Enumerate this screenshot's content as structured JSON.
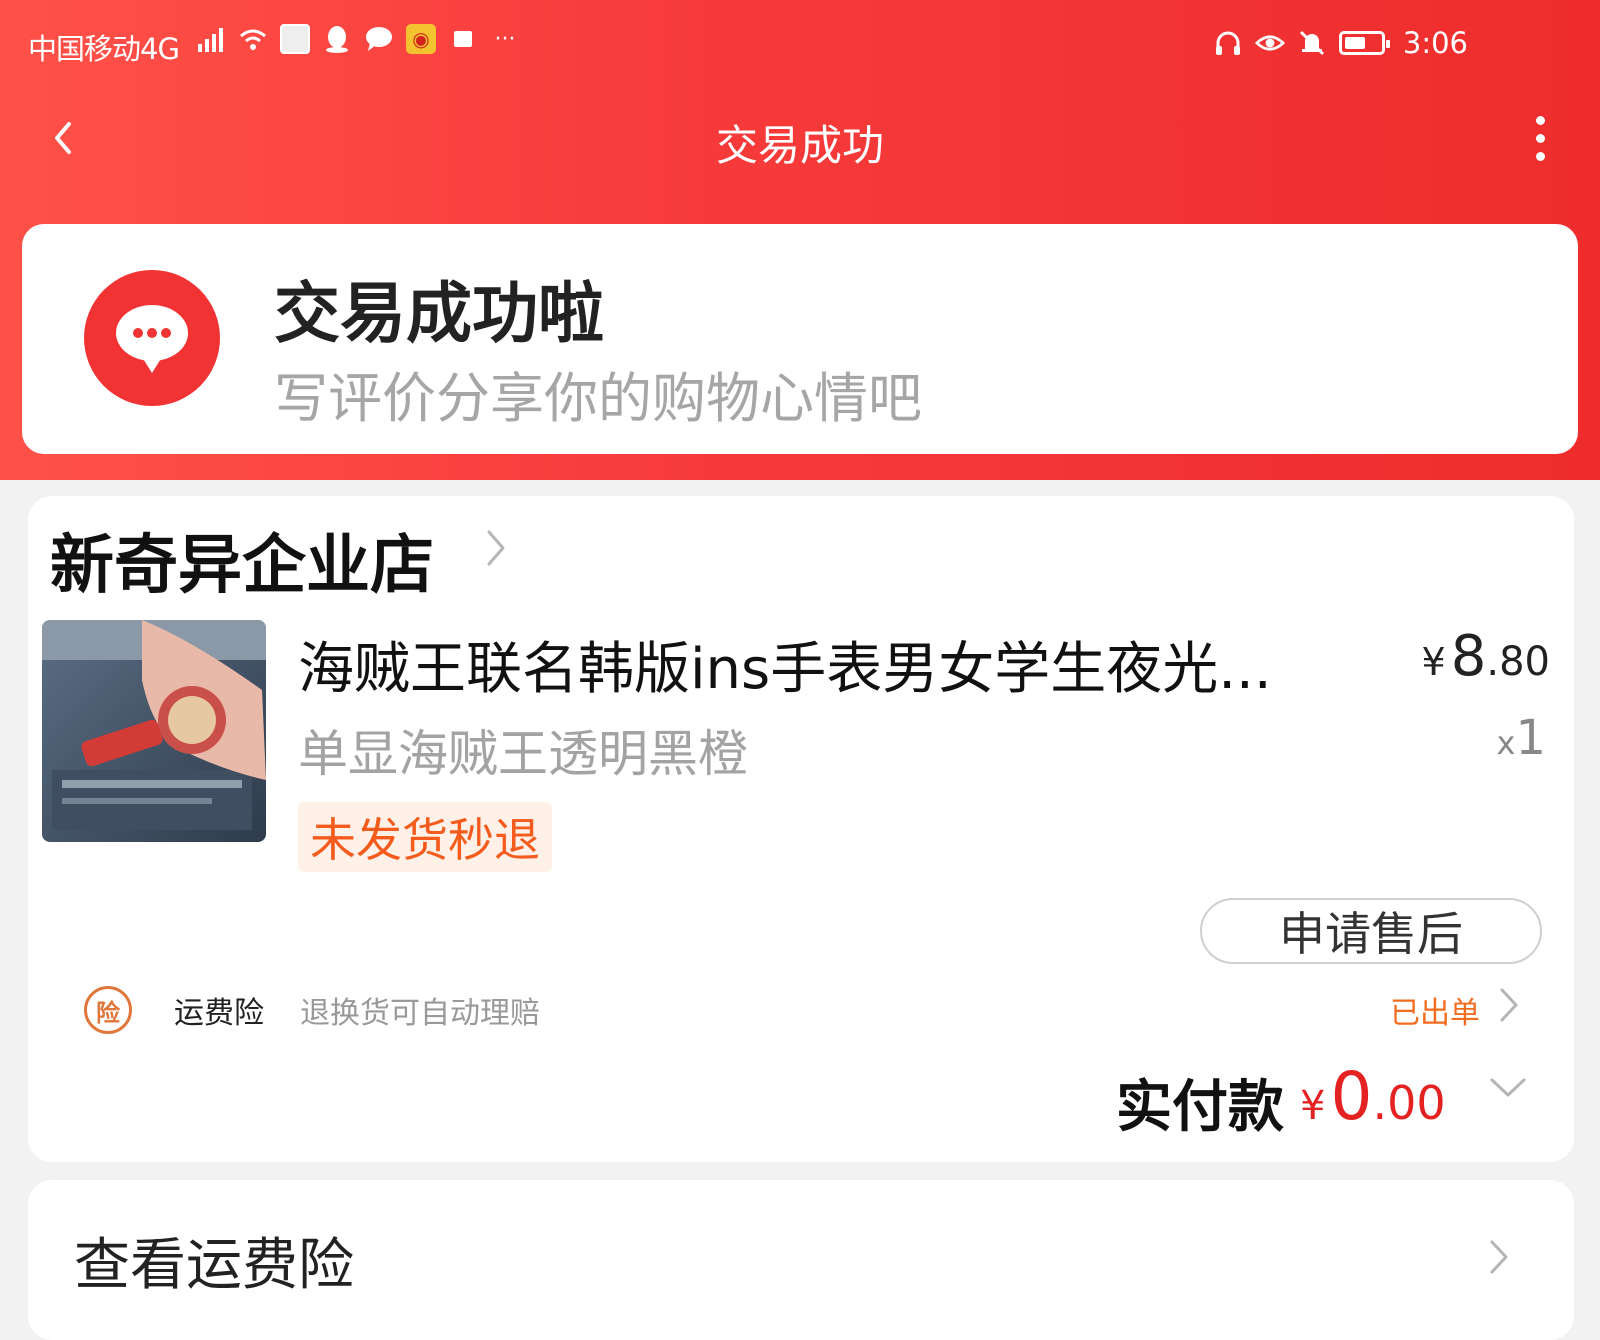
{
  "status_bar": {
    "carrier": "中国移动4G",
    "time": "3:06",
    "icons": [
      "signal-icon",
      "wifi-icon",
      "app-avatar-icon",
      "qq-icon",
      "chat-icon",
      "weibo-icon",
      "notification-icon",
      "more-notifications-icon",
      "headphones-icon",
      "eye-icon",
      "mute-icon",
      "battery-icon"
    ]
  },
  "nav": {
    "title": "交易成功"
  },
  "success": {
    "title": "交易成功啦",
    "subtitle": "写评价分享你的购物心情吧"
  },
  "store": {
    "name": "新奇异企业店"
  },
  "product": {
    "title": "海贼王联名韩版ins手表男女学生夜光...",
    "sku": "单显海贼王透明黑橙",
    "price_currency": "¥",
    "price_int": "8",
    "price_dec": ".80",
    "qty_prefix": "x",
    "qty": "1",
    "tag": "未发货秒退",
    "aftersale_button": "申请售后"
  },
  "insurance": {
    "icon_char": "险",
    "label": "运费险",
    "desc": "退换货可自动理赔",
    "status": "已出单"
  },
  "payment": {
    "label": "实付款",
    "currency": "¥",
    "amount_int": "0",
    "amount_dec": ".00"
  },
  "bottom": {
    "label": "查看运费险"
  },
  "colors": {
    "brand_red": "#f23333",
    "accent_orange": "#f46c20",
    "price_red": "#e52222"
  }
}
